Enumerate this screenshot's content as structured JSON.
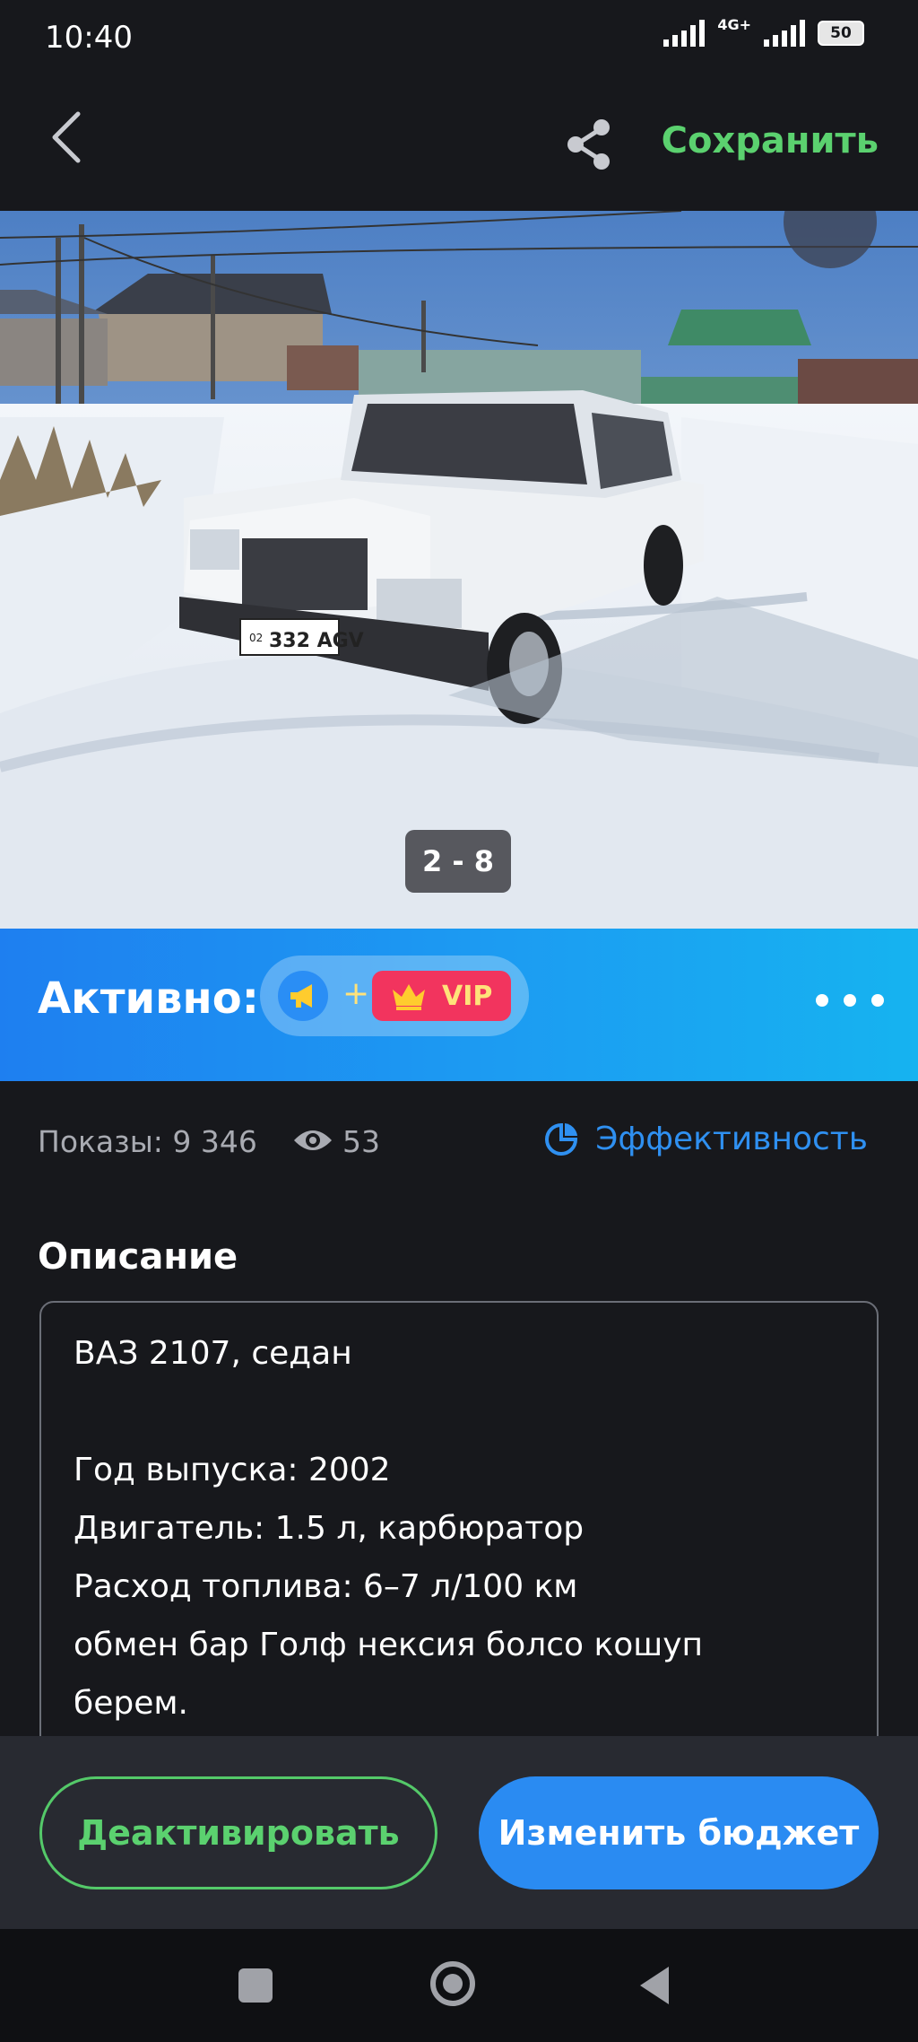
{
  "status_bar": {
    "time": "10:40",
    "network": "4G+",
    "battery": "50"
  },
  "toolbar": {
    "back_icon": "chevron-left-icon",
    "share_icon": "share-icon",
    "save_label": "Сохранить"
  },
  "gallery": {
    "counter": "2 - 8",
    "plate_text": "332 AGV",
    "plate_code": "02"
  },
  "promotion": {
    "status_label": "Активно:",
    "plus": "+",
    "vip_label": "VIP",
    "megaphone_icon": "megaphone-icon",
    "crown_icon": "crown-icon",
    "more_icon": "more-horizontal-icon",
    "colors": {
      "banner_start": "#1e7ff0",
      "banner_end": "#16b3f0",
      "vip": "#f2345e"
    }
  },
  "stats": {
    "impressions": "Показы: 9 346",
    "views": "53",
    "eye_icon": "eye-icon",
    "effectiveness_label": "Эффективность",
    "chart_icon": "pie-chart-icon"
  },
  "description": {
    "title": "Описание",
    "lines": [
      "ВАЗ 2107, седан",
      "",
      "Год выпуска: 2002",
      "Двигатель: 1.5 л, карбюратор",
      "Расход топлива: 6–7 л/100 км",
      "обмен бар Голф нексия болсо кошуп",
      "берем."
    ]
  },
  "actions": {
    "deactivate_label": "Деактивировать",
    "change_budget_label": "Изменить бюджет",
    "colors": {
      "deactivate": "#5bd16f",
      "budget": "#2a8bf2"
    }
  },
  "nav": {
    "recents_icon": "square-icon",
    "home_icon": "circle-icon",
    "back_icon": "triangle-back-icon"
  }
}
